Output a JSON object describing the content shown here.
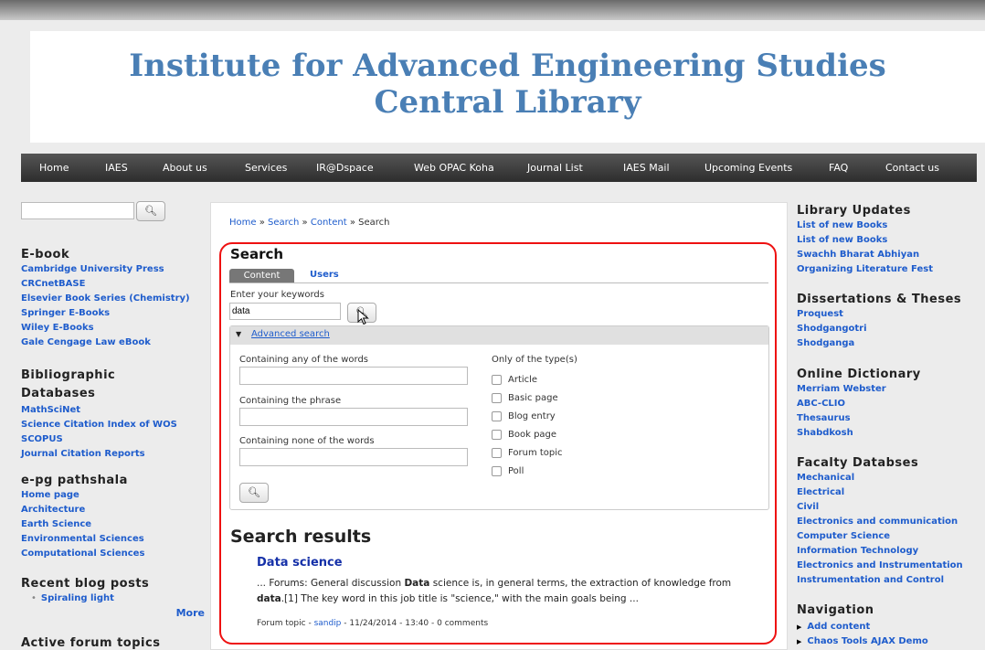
{
  "site": {
    "title_line1": "Institute for Advanced Engineering Studies",
    "title_line2": "Central Library"
  },
  "nav": [
    "Home",
    "IAES",
    "About us",
    "Services",
    "IR@Dspace",
    "Web OPAC Koha",
    "Journal List",
    "IAES Mail",
    "Upcoming Events",
    "FAQ",
    "Contact us"
  ],
  "left": {
    "search_value": "",
    "ebook": {
      "title": "E-book",
      "items": [
        "Cambridge University Press",
        "CRCnetBASE",
        "Elsevier Book Series (Chemistry)",
        "Springer E-Books",
        "Wiley E-Books",
        "Gale Cengage Law eBook"
      ]
    },
    "biblio": {
      "title1": "Bibliographic",
      "title2": "Databases",
      "items": [
        "MathSciNet",
        "Science Citation Index of WOS",
        "SCOPUS",
        "Journal Citation Reports"
      ]
    },
    "epg": {
      "title": "e-pg pathshala",
      "items": [
        "Home page",
        "Architecture",
        "Earth Science",
        "Environmental Sciences",
        "Computational Sciences"
      ]
    },
    "blog": {
      "title": "Recent blog posts",
      "item": "Spiraling light",
      "more": "More"
    },
    "forum": {
      "title": "Active forum topics"
    }
  },
  "main": {
    "breadcrumb": [
      "Home",
      "Search",
      "Content",
      "Search"
    ],
    "search_title": "Search",
    "tabs": [
      "Content",
      "Users"
    ],
    "keywords_label": "Enter your keywords",
    "keywords_value": "data",
    "advanced_label": "Advanced search",
    "any_label": "Containing any of the words",
    "phrase_label": "Containing the phrase",
    "none_label": "Containing none of the words",
    "types_label": "Only of the type(s)",
    "types": [
      "Article",
      "Basic page",
      "Blog entry",
      "Book page",
      "Forum topic",
      "Poll"
    ],
    "results_title": "Search results",
    "result": {
      "title": "Data science",
      "snippet_a": "... Forums:  General discussion ",
      "snippet_b": "Data",
      "snippet_c": " science is, in general terms, the extraction of knowledge from",
      "snippet_d": "data",
      "snippet_e": ".[1] The key word in this job title is \"science,\" with the main goals being ...",
      "meta_a": "Forum topic - ",
      "meta_user": "sandip",
      "meta_b": " - 11/24/2014 - 13:40 - 0 comments"
    }
  },
  "right": {
    "updates": {
      "title": "Library Updates",
      "items": [
        "List of new Books",
        "List of new Books",
        "Swachh Bharat Abhiyan",
        "Organizing Literature Fest"
      ]
    },
    "diss": {
      "title": "Dissertations & Theses",
      "items": [
        "Proquest",
        "Shodgangotri",
        "Shodganga"
      ]
    },
    "dict": {
      "title": "Online Dictionary",
      "items": [
        "Merriam Webster",
        "ABC-CLIO",
        "Thesaurus",
        "Shabdkosh"
      ]
    },
    "fac": {
      "title": "Facalty Databses",
      "items": [
        "Mechanical",
        "Electrical",
        "Civil",
        "Electronics and communication",
        "Computer Science",
        "Information Technology",
        "Electronics and Instrumentation",
        "Instrumentation and Control"
      ]
    },
    "navigation": {
      "title": "Navigation",
      "items": [
        "Add content",
        "Chaos Tools AJAX Demo"
      ]
    }
  },
  "icons": {
    "search": "search-icon"
  }
}
